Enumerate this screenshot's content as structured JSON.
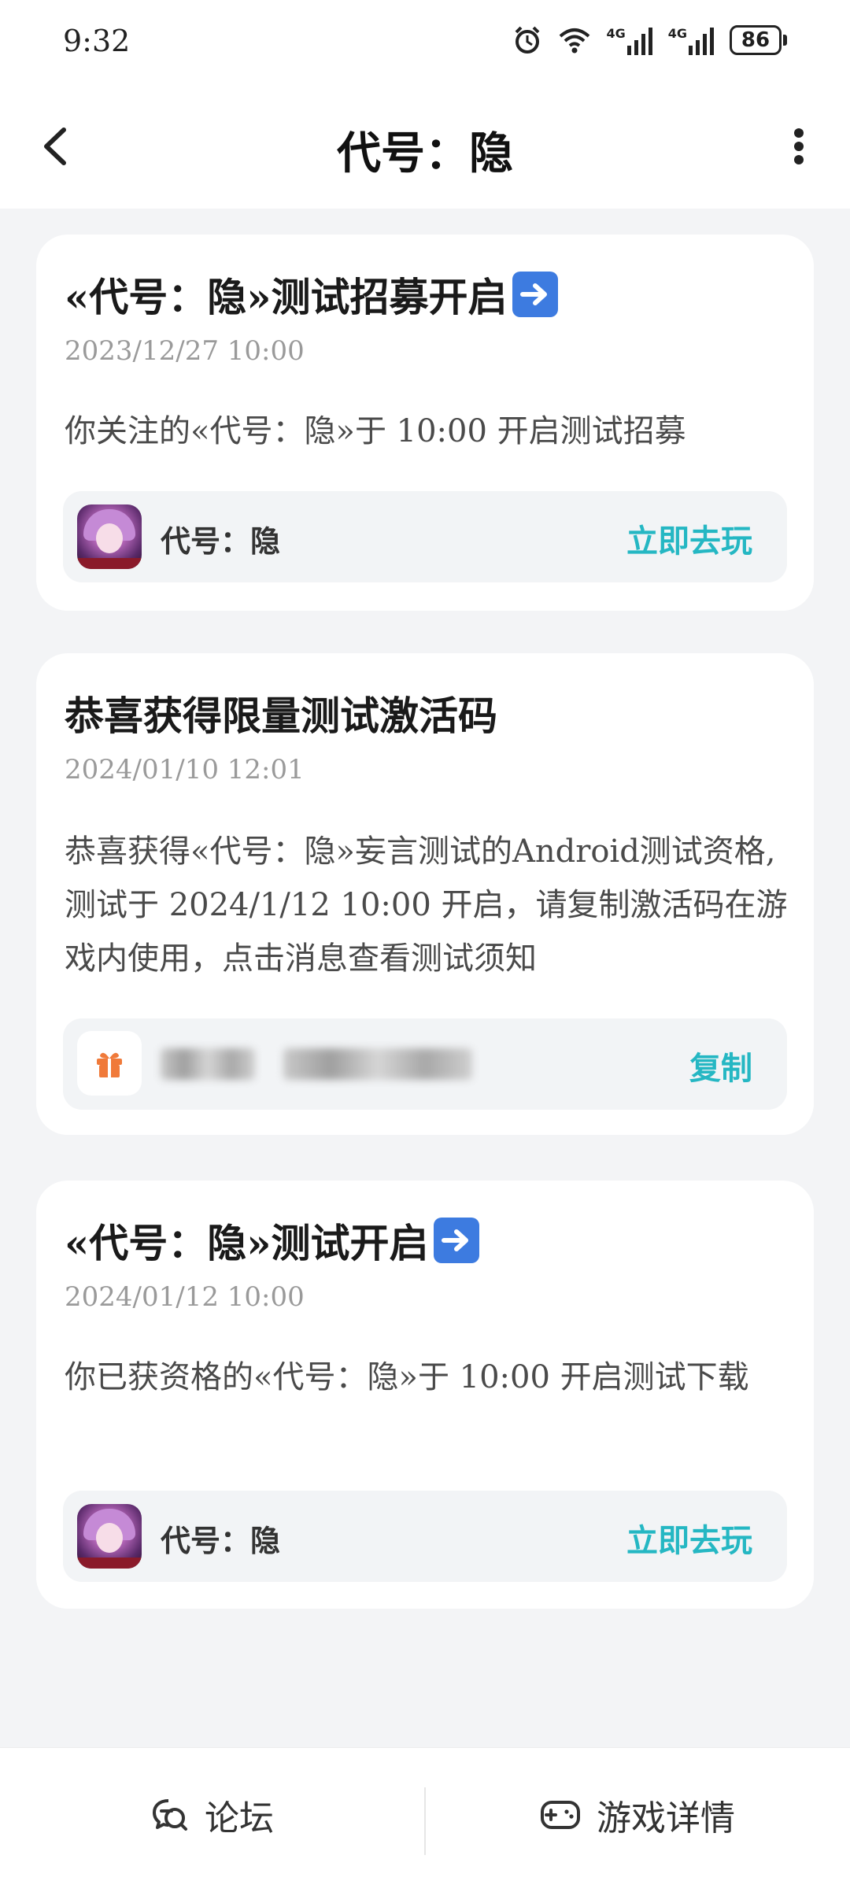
{
  "status_bar": {
    "time": "9:32",
    "network_1": "4G",
    "network_2": "4G",
    "battery": "86"
  },
  "header": {
    "title": "代号：隐"
  },
  "cards": [
    {
      "title": "«代号：隐»测试招募开启",
      "date": "2023/12/27 10:00",
      "body": "你关注的«代号：隐»于 10:00 开启测试招募",
      "game_name": "代号：隐",
      "action": "立即去玩"
    },
    {
      "title": "恭喜获得限量测试激活码",
      "date": "2024/01/10 12:01",
      "body": "恭喜获得«代号：隐»妄言测试的Android测试资格,测试于 2024/1/12 10:00 开启，请复制激活码在游戏内使用，点击消息查看测试须知",
      "action": "复制"
    },
    {
      "title": "«代号：隐»测试开启",
      "date": "2024/01/12 10:00",
      "body": "你已获资格的«代号：隐»于 10:00 开启测试下载",
      "game_name": "代号：隐",
      "action": "立即去玩"
    }
  ],
  "bottom_bar": {
    "forum": "论坛",
    "game_details": "游戏详情"
  },
  "colors": {
    "accent": "#25b7c3",
    "gift": "#f07a3a",
    "background": "#f3f4f6"
  }
}
